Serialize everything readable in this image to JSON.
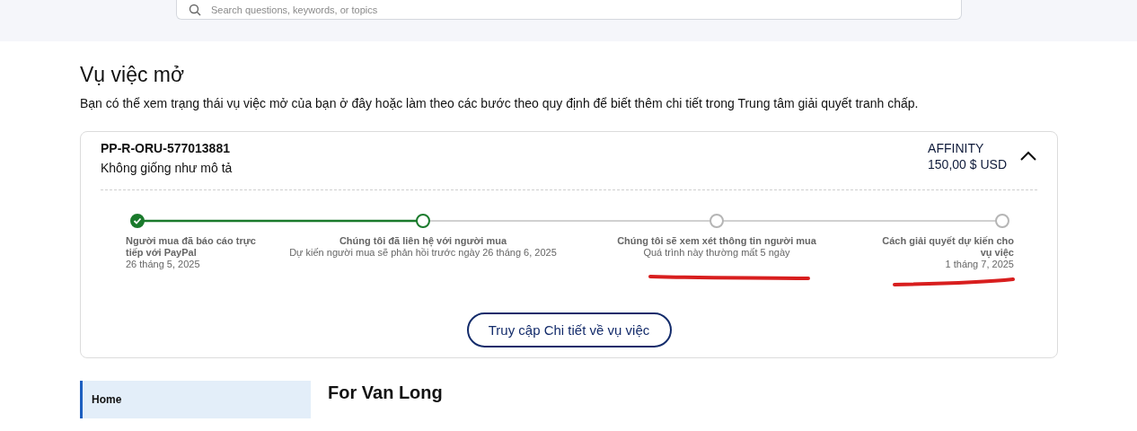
{
  "search": {
    "placeholder": "Search questions, keywords, or topics"
  },
  "open_cases": {
    "title": "Vụ việc mở",
    "description": "Bạn có thể xem trạng thái vụ việc mở của bạn ở đây hoặc làm theo các bước theo quy định để biết thêm chi tiết trong Trung tâm giải quyết tranh chấp.",
    "case": {
      "id": "PP-R-ORU-577013881",
      "reason": "Không giống như mô tả",
      "merchant": "AFFINITY",
      "amount": "150,00 $ USD",
      "expanded": true,
      "steps": [
        {
          "done": true,
          "current": false,
          "title": "Người mua đã báo cáo trực tiếp với PayPal",
          "detail": "26 tháng 5, 2025"
        },
        {
          "done": false,
          "current": true,
          "title": "Chúng tôi đã liên hệ với người mua",
          "detail": "Dự kiến người mua sẽ phản hồi trước ngày 26 tháng 6, 2025"
        },
        {
          "done": false,
          "current": false,
          "title": "Chúng tôi sẽ xem xét thông tin người mua",
          "detail": "Quá trình này thường mất 5 ngày"
        },
        {
          "done": false,
          "current": false,
          "title": "Cách giải quyết dự kiến cho vụ việc",
          "detail": "1 tháng 7, 2025"
        }
      ],
      "button": "Truy cập Chi tiết về vụ việc"
    }
  },
  "sidebar": {
    "items": [
      {
        "label": "Home",
        "selected": true
      }
    ]
  },
  "greeting": "For Van Long"
}
